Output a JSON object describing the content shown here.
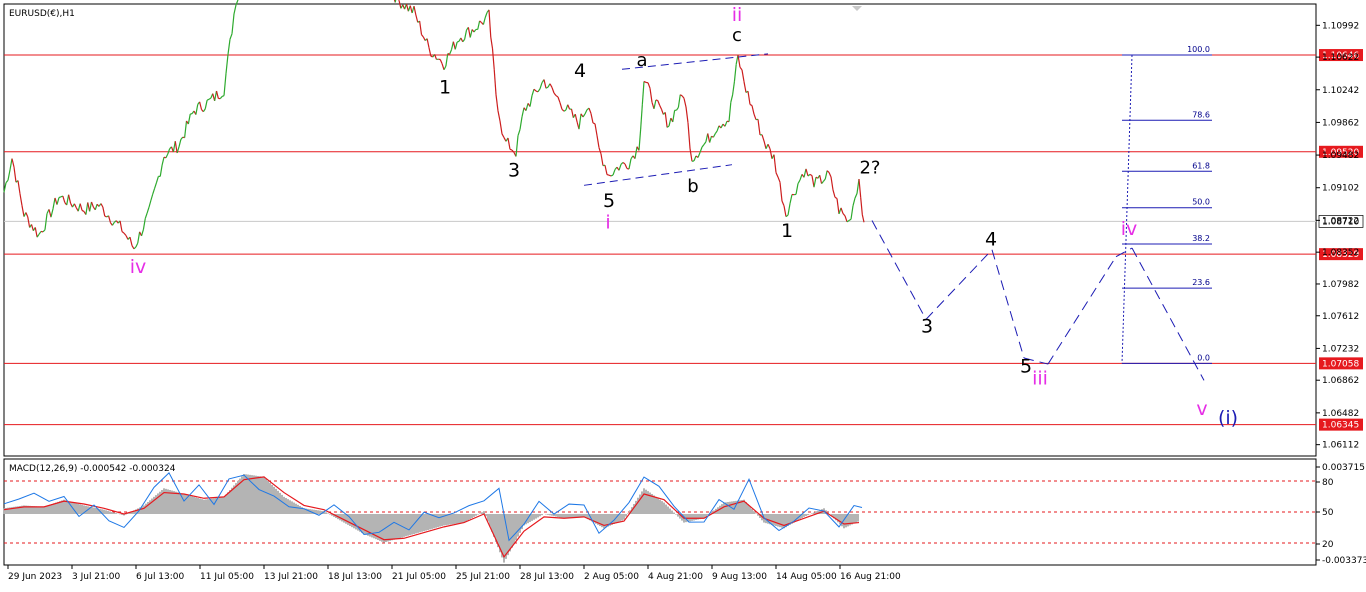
{
  "chart_data": {
    "type": "line",
    "price_panel": {
      "title": "EURUSD(€),H1",
      "y_range": [
        1.0598,
        1.1124
      ],
      "y_ticks": [
        "1.10992",
        "1.10622",
        "1.10242",
        "1.09862",
        "1.09482",
        "1.09102",
        "1.08722",
        "1.08352",
        "1.07982",
        "1.07612",
        "1.07232",
        "1.06862",
        "1.06482",
        "1.06112"
      ],
      "horizontal_levels": [
        "1.10646",
        "1.09520",
        "1.08329",
        "1.07058",
        "1.06345"
      ],
      "current_price": "1.08710",
      "price_series": {
        "x_index": [
          0,
          8,
          20,
          35,
          55,
          80,
          95,
          118,
          130,
          145,
          160,
          175,
          190,
          205,
          220,
          232,
          255,
          300,
          345,
          380,
          395,
          410,
          425,
          440,
          455,
          470,
          485,
          492,
          500,
          512,
          520,
          540,
          560,
          575,
          585,
          595,
          605,
          615,
          625,
          635,
          640,
          650,
          665,
          680,
          688,
          700,
          715,
          725,
          734,
          742,
          752,
          762,
          770,
          782,
          790,
          800,
          812,
          825,
          835,
          845,
          855,
          860
        ],
        "close": [
          1.0905,
          1.0945,
          1.088,
          1.0855,
          1.09,
          1.0885,
          1.089,
          1.0862,
          1.084,
          1.088,
          1.0948,
          1.096,
          1.1,
          1.101,
          1.1025,
          1.113,
          1.1155,
          1.1205,
          1.118,
          1.115,
          1.1128,
          1.1115,
          1.1072,
          1.1055,
          1.1085,
          1.1095,
          1.111,
          1.102,
          1.0965,
          1.0952,
          1.1,
          1.1035,
          1.1005,
          1.0985,
          1.101,
          1.0955,
          1.0925,
          1.0935,
          1.094,
          1.096,
          1.1035,
          1.101,
          1.0985,
          1.102,
          1.0945,
          1.096,
          1.0985,
          1.099,
          1.1062,
          1.1025,
          1.099,
          1.096,
          1.0945,
          1.088,
          1.0905,
          1.093,
          1.0915,
          1.0925,
          1.0885,
          1.087,
          1.092,
          1.087
        ]
      }
    },
    "projection_path": {
      "x_index": [
        868,
        922,
        988,
        1020,
        1044,
        1112,
        1128,
        1200
      ],
      "y": [
        1.0872,
        1.0757,
        1.0838,
        1.0712,
        1.0705,
        1.083,
        1.084,
        1.0686
      ]
    },
    "wave_labels": [
      {
        "text": "ii",
        "x_index": 733,
        "y": 1.1104,
        "color": "#e62ee6"
      },
      {
        "text": "c",
        "x_index": 733,
        "y": 1.1081,
        "color": "#000000"
      },
      {
        "text": "a",
        "x_index": 638,
        "y": 1.1052,
        "color": "#000000"
      },
      {
        "text": "4",
        "x_index": 576,
        "y": 1.1039,
        "color": "#000000"
      },
      {
        "text": "1",
        "x_index": 441,
        "y": 1.102,
        "color": "#000000"
      },
      {
        "text": "3",
        "x_index": 510,
        "y": 1.0923,
        "color": "#000000"
      },
      {
        "text": "5",
        "x_index": 605,
        "y": 1.0888,
        "color": "#000000"
      },
      {
        "text": "i",
        "x_index": 604,
        "y": 1.0863,
        "color": "#e62ee6"
      },
      {
        "text": "b",
        "x_index": 689,
        "y": 1.0905,
        "color": "#000000"
      },
      {
        "text": "2?",
        "x_index": 866,
        "y": 1.0927,
        "color": "#000000"
      },
      {
        "text": "1",
        "x_index": 783,
        "y": 1.0853,
        "color": "#000000"
      },
      {
        "text": "iv",
        "x_index": 134,
        "y": 1.0811,
        "color": "#e62ee6"
      },
      {
        "text": "4",
        "x_index": 987,
        "y": 1.0843,
        "color": "#000000"
      },
      {
        "text": "3",
        "x_index": 923,
        "y": 1.0742,
        "color": "#000000"
      },
      {
        "text": "iv",
        "x_index": 1125,
        "y": 1.0855,
        "color": "#e62ee6"
      },
      {
        "text": "5",
        "x_index": 1022,
        "y": 1.0695,
        "color": "#000000"
      },
      {
        "text": "iii",
        "x_index": 1036,
        "y": 1.0681,
        "color": "#e62ee6"
      },
      {
        "text": "v",
        "x_index": 1198,
        "y": 1.0646,
        "color": "#e62ee6"
      },
      {
        "text": "(i)",
        "x_index": 1224,
        "y": 1.0635,
        "color": "#1c1cb4"
      }
    ],
    "fibonacci": {
      "x_index": [
        1118,
        1208
      ],
      "levels": [
        {
          "label": "100.0",
          "y": 1.10646
        },
        {
          "label": "78.6",
          "y": 1.09887
        },
        {
          "label": "61.8",
          "y": 1.09293
        },
        {
          "label": "50.0",
          "y": 1.08869
        },
        {
          "label": "38.2",
          "y": 1.08447
        },
        {
          "label": "23.6",
          "y": 1.07933
        },
        {
          "label": "0.0",
          "y": 1.07058
        }
      ]
    },
    "macd_panel": {
      "title": "MACD(12,26,9) -0.000542 -0.000324",
      "y_ticks": [
        "0.003715",
        "80",
        "50",
        "20",
        "-0.003373"
      ],
      "y_range": [
        -0.003373,
        0.003715
      ],
      "stoch_levels": [
        80,
        50,
        20
      ],
      "histogram": {
        "x_index": [
          0,
          20,
          40,
          60,
          80,
          100,
          120,
          140,
          160,
          180,
          200,
          220,
          240,
          260,
          280,
          300,
          320,
          340,
          360,
          380,
          400,
          420,
          440,
          460,
          480,
          500,
          520,
          540,
          560,
          580,
          600,
          620,
          640,
          660,
          680,
          700,
          720,
          740,
          760,
          780,
          800,
          820,
          840,
          855
        ],
        "values": [
          0.0004,
          0.0006,
          0.0005,
          0.001,
          0.0006,
          0.0003,
          -0.0001,
          0.0006,
          0.0018,
          0.0014,
          0.001,
          0.0012,
          0.0028,
          0.0026,
          0.0012,
          0.0004,
          0.0002,
          -0.0006,
          -0.0014,
          -0.002,
          -0.0016,
          -0.0012,
          -0.0008,
          -0.0006,
          0.0002,
          -0.0034,
          -0.0008,
          0.0,
          -0.0003,
          -0.0002,
          -0.001,
          -0.0004,
          0.0018,
          0.0008,
          -0.0006,
          -0.0003,
          0.0008,
          0.001,
          -0.0006,
          -0.001,
          -0.0002,
          0.0004,
          -0.001,
          -0.0005
        ]
      },
      "signal": {
        "x_index": [
          0,
          20,
          40,
          60,
          80,
          100,
          120,
          140,
          160,
          180,
          200,
          220,
          240,
          260,
          280,
          300,
          320,
          340,
          360,
          380,
          400,
          420,
          440,
          460,
          480,
          500,
          520,
          540,
          560,
          580,
          600,
          620,
          640,
          660,
          680,
          700,
          720,
          740,
          760,
          780,
          800,
          820,
          840,
          855
        ],
        "values": [
          0.0003,
          0.0005,
          0.0005,
          0.0009,
          0.0007,
          0.0004,
          0.0,
          0.0004,
          0.0015,
          0.0014,
          0.0011,
          0.0012,
          0.0024,
          0.0026,
          0.0015,
          0.0006,
          0.0003,
          -0.0004,
          -0.0011,
          -0.0018,
          -0.0017,
          -0.0013,
          -0.0009,
          -0.0006,
          0.0,
          -0.003,
          -0.0012,
          -0.0002,
          -0.0003,
          -0.0002,
          -0.0008,
          -0.0005,
          0.0014,
          0.001,
          -0.0003,
          -0.0003,
          0.0005,
          0.0009,
          -0.0003,
          -0.0008,
          -0.0003,
          0.0002,
          -0.0007,
          -0.0006
        ]
      },
      "stochastic": {
        "x_index": [
          0,
          15,
          30,
          45,
          60,
          75,
          90,
          105,
          120,
          135,
          150,
          165,
          180,
          195,
          210,
          225,
          240,
          255,
          270,
          285,
          300,
          315,
          330,
          345,
          360,
          375,
          390,
          405,
          420,
          435,
          450,
          465,
          480,
          495,
          505,
          520,
          535,
          550,
          565,
          580,
          595,
          610,
          625,
          640,
          655,
          670,
          685,
          700,
          715,
          730,
          745,
          760,
          775,
          790,
          805,
          820,
          835,
          850,
          858
        ],
        "values": [
          55,
          62,
          70,
          58,
          65,
          48,
          55,
          42,
          38,
          50,
          75,
          85,
          60,
          78,
          55,
          82,
          88,
          70,
          66,
          58,
          52,
          48,
          54,
          45,
          30,
          28,
          40,
          35,
          48,
          45,
          52,
          55,
          62,
          70,
          22,
          40,
          58,
          48,
          60,
          55,
          30,
          45,
          58,
          85,
          72,
          55,
          42,
          38,
          62,
          55,
          80,
          45,
          35,
          40,
          55,
          48,
          35,
          58,
          52
        ]
      }
    },
    "x_axis": {
      "tick_labels": [
        "29 Jun 2023",
        "3 Jul 21:00",
        "6 Jul 13:00",
        "11 Jul 05:00",
        "13 Jul 21:00",
        "18 Jul 13:00",
        "21 Jul 05:00",
        "25 Jul 21:00",
        "28 Jul 13:00",
        "2 Aug 05:00",
        "4 Aug 21:00",
        "9 Aug 13:00",
        "14 Aug 05:00",
        "16 Aug 21:00"
      ],
      "tick_index": [
        4,
        68,
        132,
        196,
        260,
        324,
        388,
        452,
        516,
        580,
        644,
        708,
        772,
        836
      ]
    },
    "colors": {
      "bull": "#2eaa2e",
      "bear": "#cc1e1e",
      "level_line": "#e6191e",
      "projection": "#1c1cb4",
      "macd_hist": "#b4b4b4",
      "macd_signal": "#e6191e",
      "stoch": "#1e78e6",
      "current_line": "#c8c8c8",
      "fib_line": "#1c1cb4",
      "stoch_dash": "#e6191e"
    }
  }
}
